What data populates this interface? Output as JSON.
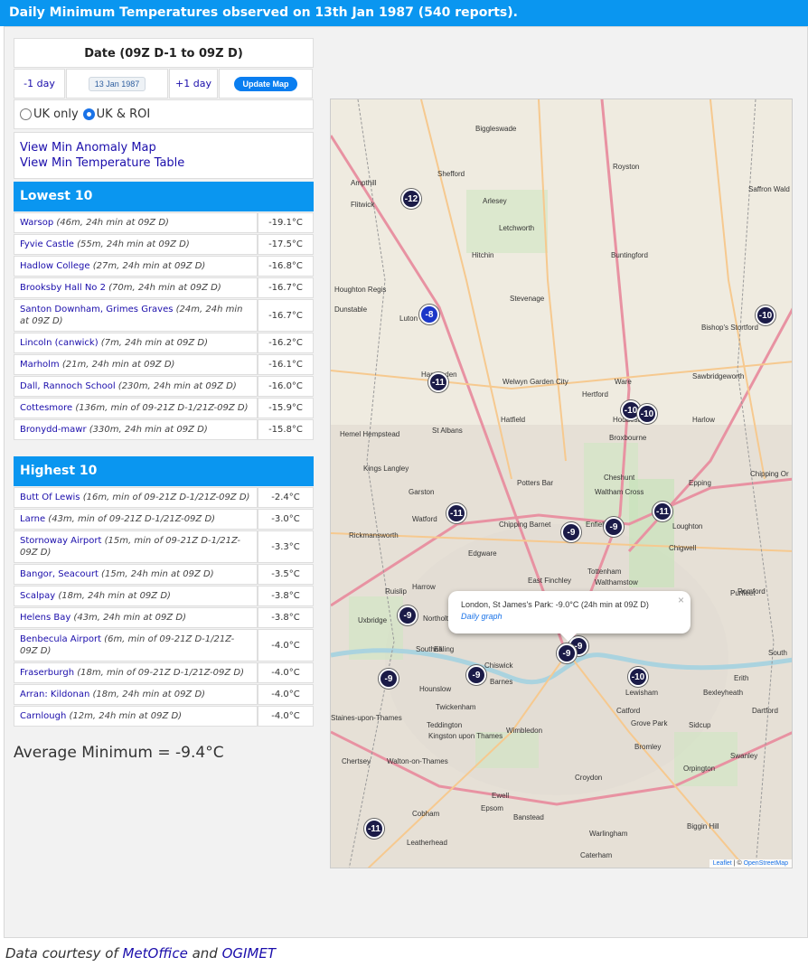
{
  "header": {
    "title": "Daily Minimum Temperatures observed on 13th Jan 1987 (540 reports)."
  },
  "date_panel": {
    "heading": "Date (09Z D-1 to 09Z D)",
    "prev_label": "-1 day",
    "date_value": "13 Jan 1987",
    "next_label": "+1 day",
    "update_label": "Update Map"
  },
  "region": {
    "uk_only": "UK only",
    "uk_roi": "UK & ROI",
    "selected": "uk_roi"
  },
  "links": {
    "anomaly": "View Min Anomaly Map",
    "table": "View Min Temperature Table"
  },
  "lowest": {
    "title": "Lowest 10",
    "rows": [
      {
        "station": "Warsop",
        "meta": " (46m, 24h min at 09Z D)",
        "value": "-19.1°C"
      },
      {
        "station": "Fyvie Castle",
        "meta": " (55m, 24h min at 09Z D)",
        "value": "-17.5°C"
      },
      {
        "station": "Hadlow College",
        "meta": " (27m, 24h min at 09Z D)",
        "value": "-16.8°C"
      },
      {
        "station": "Brooksby Hall No 2",
        "meta": " (70m, 24h min at 09Z D)",
        "value": "-16.7°C"
      },
      {
        "station": "Santon Downham, Grimes Graves",
        "meta": " (24m, 24h min at 09Z D)",
        "value": "-16.7°C"
      },
      {
        "station": "Lincoln (canwick)",
        "meta": " (7m, 24h min at 09Z D)",
        "value": "-16.2°C"
      },
      {
        "station": "Marholm",
        "meta": " (21m, 24h min at 09Z D)",
        "value": "-16.1°C"
      },
      {
        "station": "Dall, Rannoch School",
        "meta": " (230m, 24h min at 09Z D)",
        "value": "-16.0°C"
      },
      {
        "station": "Cottesmore",
        "meta": " (136m, min of 09-21Z D-1/21Z-09Z D)",
        "value": "-15.9°C"
      },
      {
        "station": "Bronydd-mawr",
        "meta": " (330m, 24h min at 09Z D)",
        "value": "-15.8°C"
      }
    ]
  },
  "highest": {
    "title": "Highest 10",
    "rows": [
      {
        "station": "Butt Of Lewis",
        "meta": " (16m, min of 09-21Z D-1/21Z-09Z D)",
        "value": "-2.4°C"
      },
      {
        "station": "Larne",
        "meta": " (43m, min of 09-21Z D-1/21Z-09Z D)",
        "value": "-3.0°C"
      },
      {
        "station": "Stornoway Airport",
        "meta": " (15m, min of 09-21Z D-1/21Z-09Z D)",
        "value": "-3.3°C"
      },
      {
        "station": "Bangor, Seacourt",
        "meta": " (15m, 24h min at 09Z D)",
        "value": "-3.5°C"
      },
      {
        "station": "Scalpay",
        "meta": " (18m, 24h min at 09Z D)",
        "value": "-3.8°C"
      },
      {
        "station": "Helens Bay",
        "meta": " (43m, 24h min at 09Z D)",
        "value": "-3.8°C"
      },
      {
        "station": "Benbecula Airport",
        "meta": " (6m, min of 09-21Z D-1/21Z-09Z D)",
        "value": "-4.0°C"
      },
      {
        "station": "Fraserburgh",
        "meta": " (18m, min of 09-21Z D-1/21Z-09Z D)",
        "value": "-4.0°C"
      },
      {
        "station": "Arran: Kildonan",
        "meta": " (18m, 24h min at 09Z D)",
        "value": "-4.0°C"
      },
      {
        "station": "Carnlough",
        "meta": " (12m, 24h min at 09Z D)",
        "value": "-4.0°C"
      }
    ]
  },
  "average": "Average Minimum = -9.4°C",
  "map": {
    "popup_text": "London, St James's Park: -9.0°C (24h min at 09Z D)",
    "popup_link": "Daily graph",
    "popup_close": "×",
    "attr_leaflet": "Leaflet",
    "attr_sep": " | © ",
    "attr_osm": "OpenStreetMap",
    "markers": [
      "-12",
      "-8",
      "-10",
      "-11",
      "-10",
      "-10",
      "-11",
      "-11",
      "-9",
      "-9",
      "-9",
      "-9",
      "-9",
      "-9",
      "-9",
      "-10",
      "-11"
    ],
    "places": [
      "Biggleswade",
      "Shefford",
      "Royston",
      "Saffron Wald",
      "Ampthill",
      "Flitwick",
      "Arlesey",
      "Letchworth",
      "Hitchin",
      "Buntingford",
      "Houghton Regis",
      "Dunstable",
      "Luton",
      "Stevenage",
      "Bishop's Stortford",
      "Harpenden",
      "Welwyn Garden City",
      "Hertford",
      "Ware",
      "Sawbridgeworth",
      "Harlow",
      "Hemel Hempstead",
      "St Albans",
      "Hatfield",
      "Hoddesdon",
      "Broxbourne",
      "Kings Langley",
      "Garston",
      "Potters Bar",
      "Cheshunt",
      "Waltham Cross",
      "Epping",
      "Chipping Or",
      "Watford",
      "Rickmansworth",
      "Chipping Barnet",
      "Enfield",
      "Loughton",
      "Chigwell",
      "Edgware",
      "East Finchley",
      "Tottenham",
      "Walthamstow",
      "Ruislip",
      "Harrow",
      "Uxbridge",
      "Northolt",
      "Southall",
      "Ealing",
      "Chiswick",
      "Barnes",
      "Hounslow",
      "Twickenham",
      "Teddington",
      "Kingston upon Thames",
      "Wimbledon",
      "Lewisham",
      "Catford",
      "Grove Park",
      "Sidcup",
      "Erith",
      "Dartford",
      "Bromley",
      "Orpington",
      "Croydon",
      "Ewell",
      "Epsom",
      "Banstead",
      "Cobham",
      "Chertsey",
      "Walton-on-Thames",
      "Staines-upon-Thames",
      "Leatherhead",
      "Warlingham",
      "Biggin Hill",
      "Caterham",
      "Swanley",
      "Bexleyheath",
      "Romford",
      "Purfleet",
      "South"
    ]
  }
}
